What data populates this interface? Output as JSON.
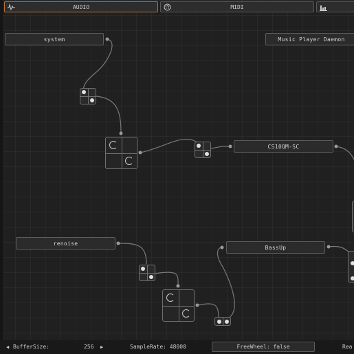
{
  "tabs": [
    {
      "label": "AUDIO",
      "icon": "waveform-icon",
      "active": true
    },
    {
      "label": "MIDI",
      "icon": "midi-connector-icon",
      "active": false
    },
    {
      "label": "",
      "icon": "bar-chart-icon",
      "active": false
    }
  ],
  "clients": {
    "system": "system",
    "music_player_daemon": "Music Player Daemon",
    "cs10qm": "CS10QM-SC",
    "renoise": "renoise",
    "bassup": "BassUp"
  },
  "status": {
    "buffer_label": "BufferSize:",
    "buffer_value": "256",
    "samplerate": "SampleRate: 48000",
    "freewheel": "FreeWheel: false",
    "realtime_partial": "Rea"
  },
  "colors": {
    "active_tab_border": "#b8733a",
    "background": "#202020",
    "wire": "#7a7a7a"
  }
}
